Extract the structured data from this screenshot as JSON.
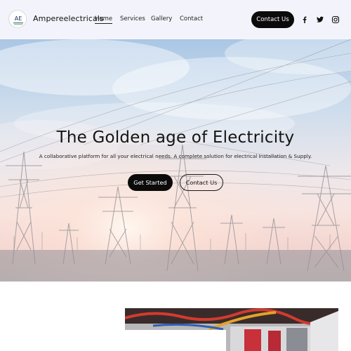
{
  "header": {
    "brand": "Ampereelectricals",
    "logo_text": "AE",
    "nav": [
      {
        "label": "Home",
        "active": true
      },
      {
        "label": "Services",
        "active": false
      },
      {
        "label": "Gallery",
        "active": false
      },
      {
        "label": "Contact",
        "active": false
      }
    ],
    "cta_label": "Contact Us",
    "social_icons": [
      "facebook-icon",
      "twitter-icon",
      "instagram-icon"
    ]
  },
  "hero": {
    "title": "The Golden age of Electricity",
    "subtitle": "A collaborative platform for all your electrical needs. A complete solution for electrical Installation & Supply.",
    "primary_button": "Get Started",
    "secondary_button": "Contact Us"
  },
  "section": {
    "heading_partial": ""
  },
  "colors": {
    "header_bg": "#f3f4fb",
    "button_dark": "#0b0b0b",
    "text": "#141414"
  }
}
